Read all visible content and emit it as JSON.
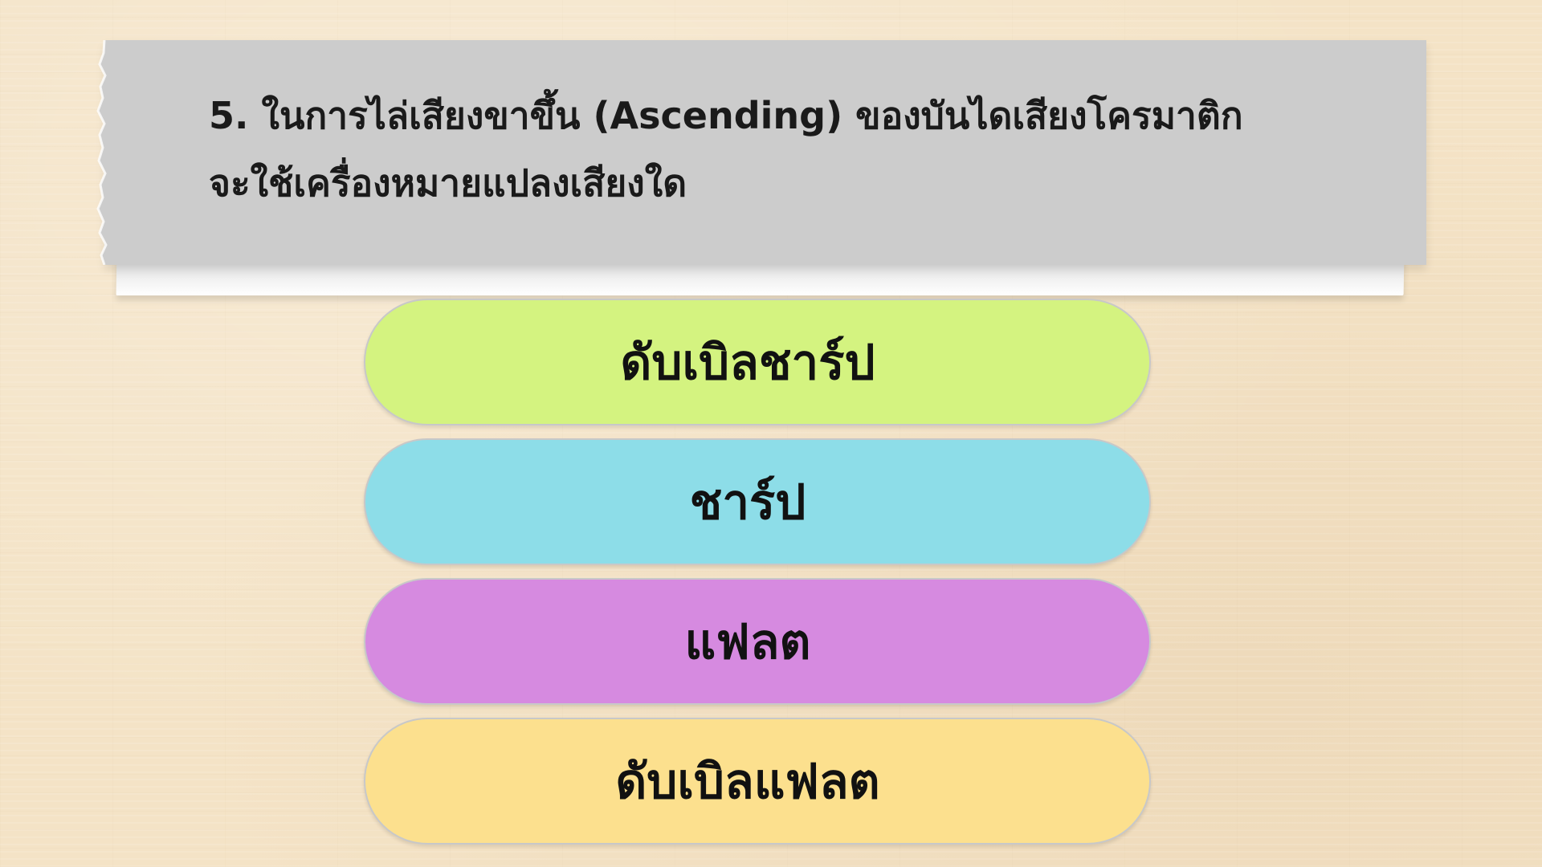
{
  "question": {
    "line1": "5. ในการไล่เสียงขาขึ้น (Ascending) ของบันไดเสียงโครมาติก",
    "line2": "จะใช้เครื่องหมายแปลงเสียงใด"
  },
  "options": [
    {
      "label": "ดับเบิลชาร์ป",
      "color": "#d4f380"
    },
    {
      "label": "ชาร์ป",
      "color": "#8ddde8"
    },
    {
      "label": "แฟลต",
      "color": "#d68ae0"
    },
    {
      "label": "ดับเบิลแฟลต",
      "color": "#fce08e"
    }
  ],
  "colors": {
    "background": "#f4e3c6",
    "question_card": "#cccccc"
  }
}
